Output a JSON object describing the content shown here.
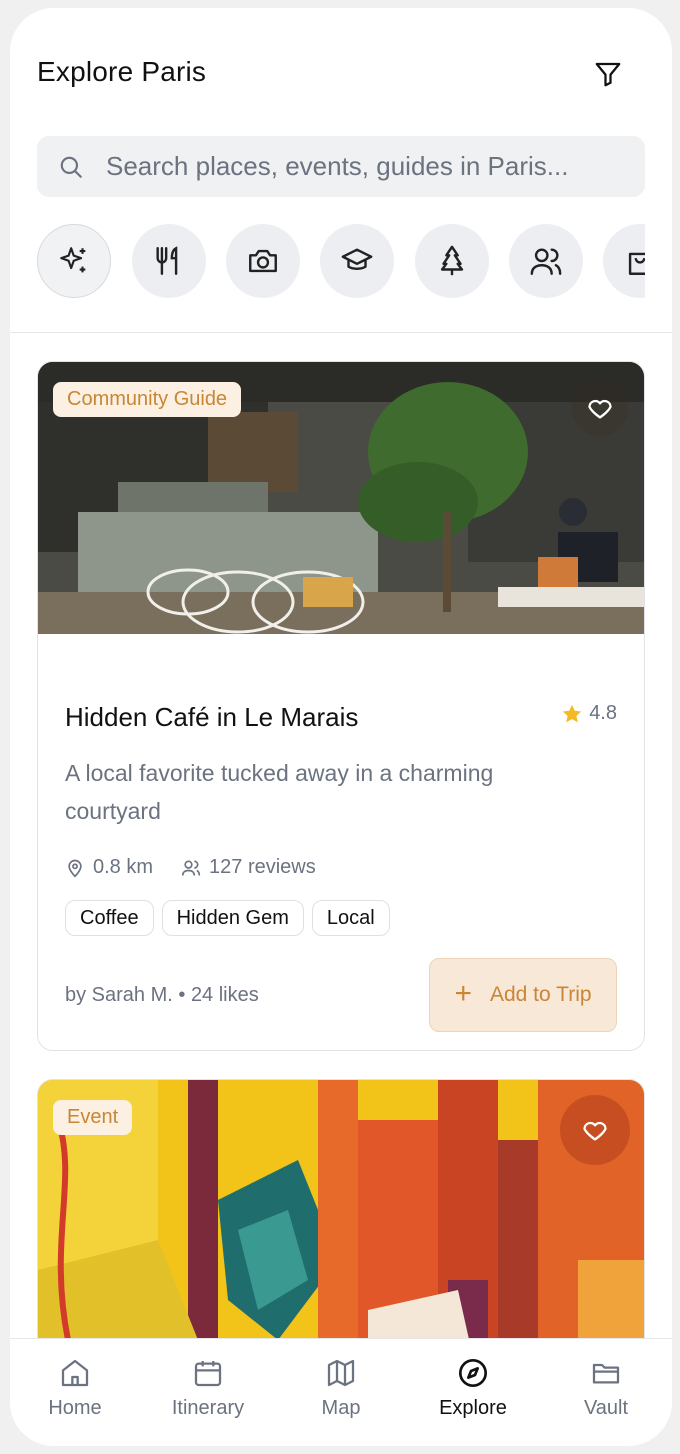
{
  "header": {
    "title": "Explore Paris"
  },
  "search": {
    "placeholder": "Search places, events, guides in Paris..."
  },
  "categories": [
    {
      "icon": "sparkles-icon",
      "active": true
    },
    {
      "icon": "utensils-icon"
    },
    {
      "icon": "camera-icon"
    },
    {
      "icon": "graduation-cap-icon"
    },
    {
      "icon": "tree-icon"
    },
    {
      "icon": "users-icon"
    },
    {
      "icon": "shopping-bag-icon"
    }
  ],
  "cards": [
    {
      "badge": "Community Guide",
      "title": "Hidden Café in Le Marais",
      "rating": "4.8",
      "description": "A local favorite tucked away in a charming courtyard",
      "distance": "0.8 km",
      "reviews": "127 reviews",
      "tags": [
        "Coffee",
        "Hidden Gem",
        "Local"
      ],
      "byline": "by Sarah M. • 24 likes",
      "action": "Add to Trip"
    },
    {
      "badge": "Event"
    }
  ],
  "nav": [
    {
      "label": "Home",
      "icon": "home-icon"
    },
    {
      "label": "Itinerary",
      "icon": "calendar-icon"
    },
    {
      "label": "Map",
      "icon": "map-icon"
    },
    {
      "label": "Explore",
      "icon": "compass-icon",
      "active": true
    },
    {
      "label": "Vault",
      "icon": "folder-icon"
    }
  ],
  "colors": {
    "accent": "#c88636",
    "accent_bg": "#f7e8d8",
    "star": "#f5b921"
  }
}
